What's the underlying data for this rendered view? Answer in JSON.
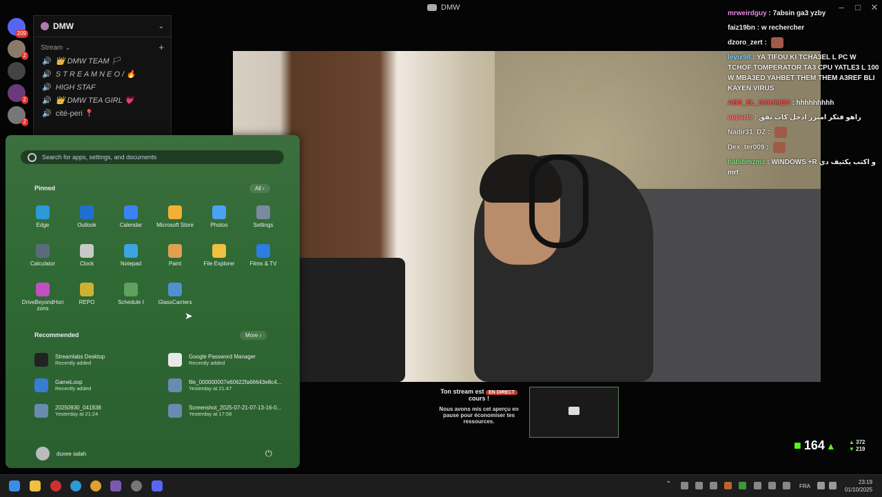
{
  "window": {
    "title": "DMW",
    "controls": [
      "minimize-icon",
      "maximize-icon",
      "close-icon"
    ]
  },
  "rail": {
    "badges": [
      "209",
      "2",
      "2",
      "2",
      "2"
    ]
  },
  "server": {
    "name": "DMW",
    "category": "Stream",
    "channels": [
      "👑 DMW TEAM 🏳",
      "S T R E A M  N E O / 🔥",
      "HIGH STAF",
      "👑 DMW TEA GIRL 💗",
      "cité-peri 📍"
    ]
  },
  "chat": [
    {
      "user": "mrweirdguy",
      "text": "7absin ga3 yzby",
      "color": "#e58be0"
    },
    {
      "user": "faiz19bn",
      "text": "w rechercher",
      "color": "#eeeeee"
    },
    {
      "user": "dzoro_zert",
      "text": "",
      "color": "#eeeeee",
      "emote": true
    },
    {
      "user": "levix98",
      "text": "YA TIFOU KI TCHA3EL L PC W TCHOF TOMPERATOR TA3 CPU YATLE3 L 100 W MBA3ED YAHBET THEM THEM A3REF BLI KAYEN VIRUS",
      "color": "#7bd0ff"
    },
    {
      "user": "ABS_EL_MOUMEN",
      "text": "hhhhhhhhh",
      "color": "#ff4d4d"
    },
    {
      "user": "anparts",
      "text": "راهو فتكر امتزر ادخل كاث تفق",
      "color": "#ff7a7a"
    },
    {
      "user": "Nadir31_DZ",
      "text": "",
      "color": "#dddddd",
      "emote": true
    },
    {
      "user": "Dex_ter009",
      "text": "",
      "color": "#dddddd",
      "emote": true
    },
    {
      "user": "habibmzmz",
      "text": "WINDOWS +R و اكتب يكثيف دي mrt",
      "color": "#7ee07e"
    }
  ],
  "start_menu": {
    "search_placeholder": "Search for apps, settings, and documents",
    "pinned_title": "Pinned",
    "all_label": "All  ›",
    "pinned": [
      {
        "label": "Edge",
        "icon": "edge-icon",
        "color": "#2a9ad8"
      },
      {
        "label": "Outlook",
        "icon": "outlook-icon",
        "color": "#1f6fd0"
      },
      {
        "label": "Calendar",
        "icon": "calendar-icon",
        "color": "#3b82f6"
      },
      {
        "label": "Microsoft Store",
        "icon": "store-icon",
        "color": "#f2b134"
      },
      {
        "label": "Photos",
        "icon": "photos-icon",
        "color": "#4aa3f0"
      },
      {
        "label": "Settings",
        "icon": "settings-icon",
        "color": "#7a8aa0"
      },
      {
        "label": "Calculator",
        "icon": "calculator-icon",
        "color": "#5b6b7b"
      },
      {
        "label": "Clock",
        "icon": "clock-icon",
        "color": "#c9c9c9"
      },
      {
        "label": "Notepad",
        "icon": "notepad-icon",
        "color": "#3aa5e0"
      },
      {
        "label": "Paint",
        "icon": "paint-icon",
        "color": "#e0a050"
      },
      {
        "label": "File Explorer",
        "icon": "folder-icon",
        "color": "#f0c040"
      },
      {
        "label": "Films & TV",
        "icon": "films-icon",
        "color": "#2b7de0"
      },
      {
        "label": "DriveBeyondHorizons",
        "icon": "drivebeyond-icon",
        "color": "#c050c0"
      },
      {
        "label": "REPO",
        "icon": "repo-icon",
        "color": "#d0b030"
      },
      {
        "label": "Schedule I",
        "icon": "schedule-icon",
        "color": "#60a060"
      },
      {
        "label": "GlassCarriers",
        "icon": "glasscarriers-icon",
        "color": "#5090d0"
      }
    ],
    "recommended_title": "Recommended",
    "more_label": "More  ›",
    "recommended": [
      {
        "title": "Streamlabs Desktop",
        "sub": "Recently added",
        "icon": "streamlabs-icon",
        "color": "#222"
      },
      {
        "title": "Google Password Manager",
        "sub": "Recently added",
        "icon": "password-icon",
        "color": "#e8e8e8"
      },
      {
        "title": "GameLoop",
        "sub": "Recently added",
        "icon": "gameloop-icon",
        "color": "#3a7bd5"
      },
      {
        "title": "file_000000007e60622fa66643e8c4...",
        "sub": "Yesterday at 21:47",
        "icon": "file-icon",
        "color": "#6a8ab0"
      },
      {
        "title": "20250930_041938",
        "sub": "Yesterday at 21:24",
        "icon": "image-file-icon",
        "color": "#6a8ab0"
      },
      {
        "title": "Screenshot_2025-07-21-07-13-16-0...",
        "sub": "Yesterday at 17:58",
        "icon": "image-file-icon",
        "color": "#6a8ab0"
      }
    ],
    "user": "duxee salah"
  },
  "live_notice": {
    "line1": "Ton stream est",
    "badge": "EN DIRECT",
    "line2": "cours !",
    "sub": "Nous avons mis cet aperçu en pause pour économiser tes ressources."
  },
  "stats": {
    "viewers": "164",
    "subs_top": "372",
    "subs_bottom": "219"
  },
  "taskbar": {
    "lang": "FRA",
    "time": "23:19",
    "date": "01/10/2025"
  }
}
